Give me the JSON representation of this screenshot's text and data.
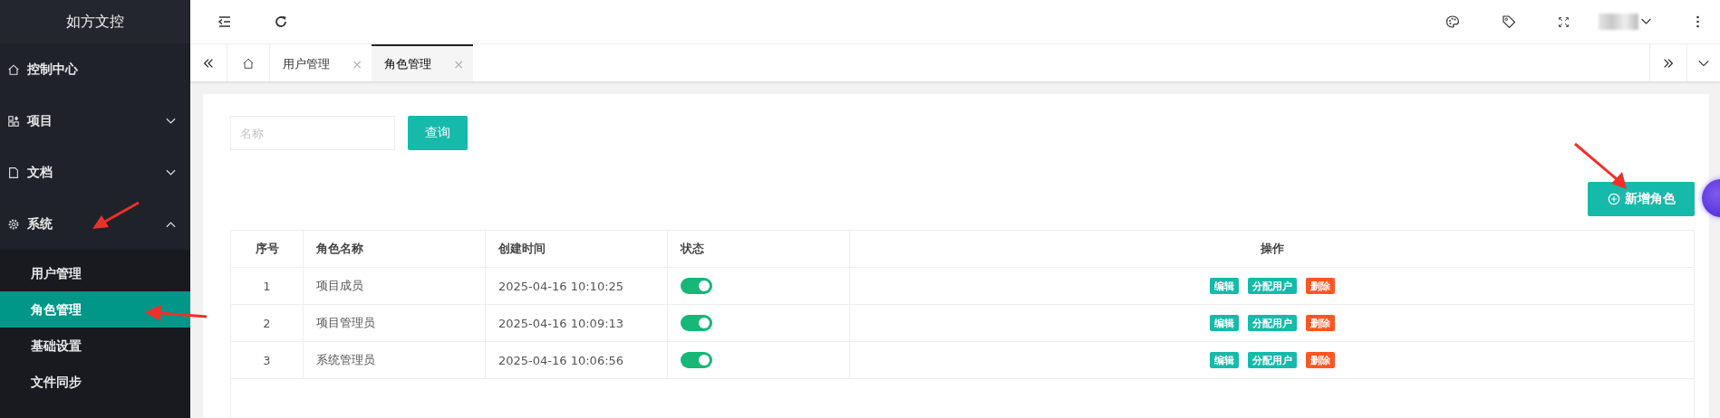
{
  "sidebar": {
    "logo": "如方文控",
    "items": [
      {
        "label": "控制中心",
        "kind": "home",
        "selected": false
      },
      {
        "label": "项目",
        "kind": "grid",
        "expanded": false,
        "selected": false
      },
      {
        "label": "文档",
        "kind": "doc",
        "expanded": false,
        "selected": false
      },
      {
        "label": "系统",
        "kind": "gear",
        "expanded": true,
        "selected": false,
        "children": [
          {
            "label": "用户管理",
            "selected": false
          },
          {
            "label": "角色管理",
            "selected": true
          },
          {
            "label": "基础设置",
            "selected": false
          },
          {
            "label": "文件同步",
            "selected": false
          }
        ]
      }
    ]
  },
  "tabs": [
    {
      "label": "用户管理",
      "close": "×",
      "selected": false
    },
    {
      "label": "角色管理",
      "close": "×",
      "selected": true
    }
  ],
  "search": {
    "placeholder": "名称",
    "button": "查询"
  },
  "add_button": "新增角色",
  "table": {
    "columns": [
      "序号",
      "角色名称",
      "创建时间",
      "状态",
      "操作"
    ],
    "rows": [
      {
        "index": "1",
        "name": "项目成员",
        "created": "2025-04-16 10:10:25",
        "on": true,
        "actions": [
          {
            "label": "编辑",
            "kind": "edit"
          },
          {
            "label": "分配用户",
            "kind": "assign"
          },
          {
            "label": "删除",
            "kind": "delete"
          }
        ]
      },
      {
        "index": "2",
        "name": "项目管理员",
        "created": "2025-04-16 10:09:13",
        "on": true,
        "actions": [
          {
            "label": "编辑",
            "kind": "edit"
          },
          {
            "label": "分配用户",
            "kind": "assign"
          },
          {
            "label": "删除",
            "kind": "delete"
          }
        ]
      },
      {
        "index": "3",
        "name": "系统管理员",
        "created": "2025-04-16 10:06:56",
        "on": true,
        "actions": [
          {
            "label": "编辑",
            "kind": "edit"
          },
          {
            "label": "分配用户",
            "kind": "assign"
          },
          {
            "label": "删除",
            "kind": "delete"
          }
        ]
      }
    ]
  }
}
